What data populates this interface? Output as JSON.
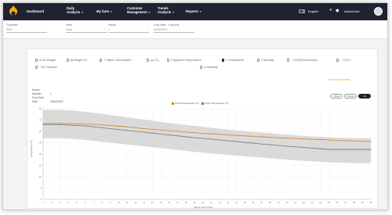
{
  "nav": {
    "items": [
      {
        "label": "Dashboard",
        "has_menu": false
      },
      {
        "label": "Daily Analysis",
        "has_menu": true
      },
      {
        "label": "My farm",
        "has_menu": true
      },
      {
        "label": "Customer Management",
        "has_menu": true
      },
      {
        "label": "Trends Analysis",
        "has_menu": true
      },
      {
        "label": "Reports",
        "has_menu": true
      }
    ],
    "language": "English",
    "user": "AdminUser"
  },
  "filters": [
    {
      "label": "Customer",
      "value": "ISFA"
    },
    {
      "label": "Farm",
      "value": "Farm"
    },
    {
      "label": "House",
      "value": "1"
    },
    {
      "label": "Crop Start - Crop end",
      "value": "02/02/2023"
    }
  ],
  "parameters": [
    {
      "label": "Air Weight",
      "checked": false,
      "icon": "scale-icon"
    },
    {
      "label": "Weight CV",
      "checked": false,
      "icon": "chart-icon"
    },
    {
      "label": "Water Consumption",
      "checked": false,
      "icon": "tap-icon"
    },
    {
      "label": "CO₂",
      "checked": false,
      "icon": "cloud-icon"
    },
    {
      "label": "Apparent Temperature",
      "checked": false,
      "icon": "thermo-icon"
    },
    {
      "label": "Temperature",
      "checked": true,
      "icon": "thermo-icon"
    },
    {
      "label": "Humidity",
      "checked": false,
      "icon": "drop-icon"
    },
    {
      "label": "CO2(Scurbolevels)",
      "checked": false,
      "icon": "bulb-icon"
    },
    {
      "label": "CO2 L",
      "checked": false,
      "icon": "bulb-icon"
    },
    {
      "label": "Air Pressure",
      "checked": false,
      "icon": "gauge-icon"
    },
    {
      "label": "Mortality",
      "checked": false,
      "icon": "skull-icon"
    }
  ],
  "show_link": "Show all parameters",
  "meta": {
    "house_label": "House Number",
    "house_value": "1",
    "date_label": "Crop Start Date",
    "date_value": "02/02/2023"
  },
  "buttons": [
    "1 Week",
    "2 Weeks",
    "All"
  ],
  "chart_data": {
    "type": "line",
    "title": "",
    "xlabel": "Age of Crop in days",
    "ylabel": "Temperature (°C)",
    "x": [
      1,
      2,
      3,
      4,
      5,
      6,
      7,
      8,
      9,
      10,
      11,
      12,
      13,
      14,
      15,
      16,
      17,
      18,
      19,
      20,
      21,
      22,
      23,
      24,
      25,
      26,
      27,
      28,
      29,
      30,
      31,
      32,
      33,
      34,
      35,
      36,
      37,
      38,
      39,
      40
    ],
    "ylim": [
      0,
      40
    ],
    "yticks": [
      0,
      5,
      10,
      15,
      20,
      25,
      30,
      35,
      40
    ],
    "series": [
      {
        "name": "Actual Temperature (°C)",
        "color": "#d9832a",
        "values": [
          33.5,
          33.5,
          33.5,
          33.4,
          33.3,
          33.2,
          33.1,
          32.9,
          32.6,
          32.3,
          32.0,
          31.6,
          31.2,
          30.9,
          30.6,
          30.3,
          30.0,
          29.7,
          29.4,
          29.1,
          28.9,
          28.7,
          28.4,
          28.2,
          28.0,
          27.8,
          27.6,
          27.4,
          27.2,
          27.0,
          26.9,
          26.7,
          26.5,
          26.4,
          26.2,
          26.0,
          25.9,
          25.7,
          25.6,
          25.5
        ]
      },
      {
        "name": "Target Temperature (°C)",
        "color": "#7a7a7a",
        "values": [
          33.0,
          33.0,
          33.0,
          32.8,
          32.6,
          32.4,
          32.0,
          31.6,
          31.2,
          30.8,
          30.4,
          30.0,
          29.6,
          29.2,
          28.8,
          28.4,
          28.0,
          27.6,
          27.2,
          26.9,
          26.6,
          26.2,
          25.8,
          25.5,
          25.1,
          24.8,
          24.4,
          24.1,
          23.8,
          23.5,
          23.2,
          22.9,
          22.6,
          22.3,
          22.0,
          22.0,
          22.0,
          22.0,
          22.0,
          22.0
        ]
      }
    ],
    "band": {
      "upper": [
        39.5,
        39.5,
        39.5,
        39.3,
        39.0,
        38.6,
        38.2,
        37.7,
        37.2,
        36.7,
        36.2,
        35.7,
        35.2,
        34.7,
        34.2,
        33.7,
        33.3,
        32.8,
        32.4,
        32.0,
        31.6,
        31.2,
        30.8,
        30.4,
        30.1,
        29.8,
        29.5,
        29.2,
        28.9,
        28.6,
        28.3,
        28.0,
        27.8,
        27.6,
        27.4,
        27.2,
        27.1,
        27.0,
        27.0,
        27.0
      ],
      "lower": [
        27.0,
        27.0,
        27.0,
        26.8,
        26.5,
        26.2,
        25.8,
        25.4,
        25.0,
        24.6,
        24.2,
        23.8,
        23.4,
        23.0,
        22.6,
        22.2,
        21.8,
        21.4,
        21.0,
        20.6,
        20.3,
        20.0,
        19.6,
        19.3,
        19.0,
        18.7,
        18.4,
        18.1,
        17.8,
        17.5,
        17.2,
        17.0,
        16.8,
        16.6,
        16.4,
        16.2,
        16.1,
        16.0,
        16.0,
        16.0
      ],
      "color": "#dadada"
    },
    "legend_position": "top-center",
    "grid": true
  }
}
